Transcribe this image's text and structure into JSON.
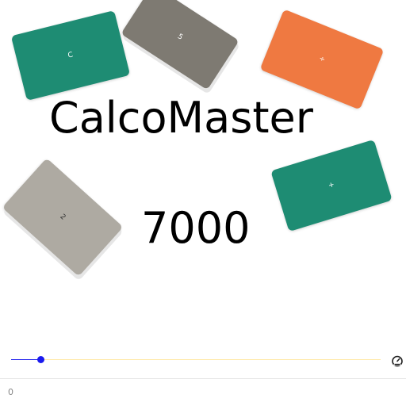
{
  "title": {
    "line1": "CalcoMaster",
    "line2": "7000"
  },
  "cards": {
    "c": {
      "label": "C",
      "color": "#1e8c73"
    },
    "five": {
      "label": "5",
      "color": "#7e7a72"
    },
    "div": {
      "label": "÷",
      "color": "#ef7941"
    },
    "plus": {
      "label": "+",
      "color": "#1e8c73"
    },
    "two": {
      "label": "2",
      "color": "#aeaaa2"
    }
  },
  "slider": {
    "value": 0.08,
    "fill_color": "#2222ee",
    "track_color": "#ffe9a8"
  },
  "speed_icon": "speedometer-icon",
  "status": {
    "value": "0"
  }
}
